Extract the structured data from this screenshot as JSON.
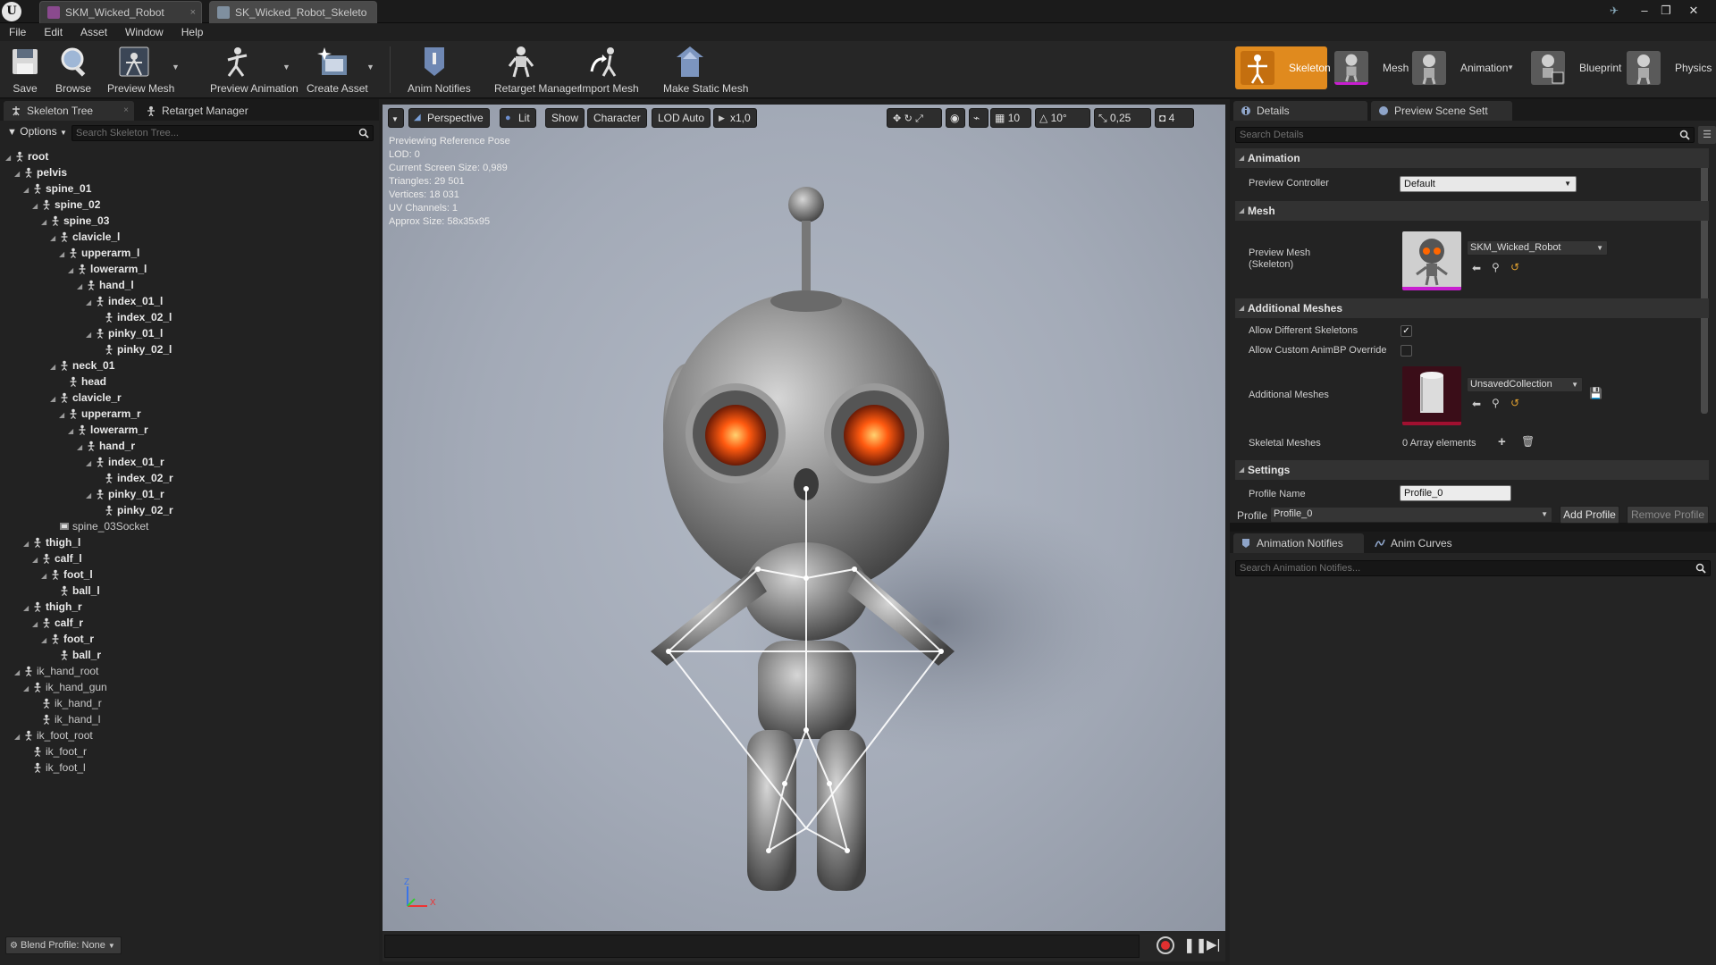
{
  "titlebar": {
    "tabs": [
      {
        "label": "SKM_Wicked_Robot"
      },
      {
        "label": "SK_Wicked_Robot_Skeleto"
      }
    ]
  },
  "menu": [
    "File",
    "Edit",
    "Asset",
    "Window",
    "Help"
  ],
  "toolbar": {
    "buttons": [
      {
        "label": "Save"
      },
      {
        "label": "Browse"
      },
      {
        "label": "Preview Mesh"
      },
      {
        "label": "Preview Animation"
      },
      {
        "label": "Create Asset"
      },
      {
        "label": "Anim Notifies"
      },
      {
        "label": "Retarget Manager"
      },
      {
        "label": "Import Mesh"
      },
      {
        "label": "Make Static Mesh"
      }
    ],
    "modes": [
      {
        "label": "Skeleton"
      },
      {
        "label": "Mesh"
      },
      {
        "label": "Animation"
      },
      {
        "label": "Blueprint"
      },
      {
        "label": "Physics"
      }
    ]
  },
  "left_panel": {
    "tabs": [
      "Skeleton Tree",
      "Retarget Manager"
    ],
    "options_label": "Options",
    "search_placeholder": "Search Skeleton Tree...",
    "tree": [
      {
        "name": "root",
        "depth": 0,
        "bold": true
      },
      {
        "name": "pelvis",
        "depth": 1,
        "bold": true
      },
      {
        "name": "spine_01",
        "depth": 2,
        "bold": true
      },
      {
        "name": "spine_02",
        "depth": 3,
        "bold": true
      },
      {
        "name": "spine_03",
        "depth": 4,
        "bold": true
      },
      {
        "name": "clavicle_l",
        "depth": 5,
        "bold": true
      },
      {
        "name": "upperarm_l",
        "depth": 6,
        "bold": true
      },
      {
        "name": "lowerarm_l",
        "depth": 7,
        "bold": true
      },
      {
        "name": "hand_l",
        "depth": 8,
        "bold": true
      },
      {
        "name": "index_01_l",
        "depth": 9,
        "bold": true
      },
      {
        "name": "index_02_l",
        "depth": 10,
        "bold": true
      },
      {
        "name": "pinky_01_l",
        "depth": 9,
        "bold": true
      },
      {
        "name": "pinky_02_l",
        "depth": 10,
        "bold": true
      },
      {
        "name": "neck_01",
        "depth": 5,
        "bold": true
      },
      {
        "name": "head",
        "depth": 6,
        "bold": true
      },
      {
        "name": "clavicle_r",
        "depth": 5,
        "bold": true
      },
      {
        "name": "upperarm_r",
        "depth": 6,
        "bold": true
      },
      {
        "name": "lowerarm_r",
        "depth": 7,
        "bold": true
      },
      {
        "name": "hand_r",
        "depth": 8,
        "bold": true
      },
      {
        "name": "index_01_r",
        "depth": 9,
        "bold": true
      },
      {
        "name": "index_02_r",
        "depth": 10,
        "bold": true
      },
      {
        "name": "pinky_01_r",
        "depth": 9,
        "bold": true
      },
      {
        "name": "pinky_02_r",
        "depth": 10,
        "bold": true
      },
      {
        "name": "spine_03Socket",
        "depth": 5,
        "bold": false,
        "socket": true
      },
      {
        "name": "thigh_l",
        "depth": 2,
        "bold": true
      },
      {
        "name": "calf_l",
        "depth": 3,
        "bold": true
      },
      {
        "name": "foot_l",
        "depth": 4,
        "bold": true
      },
      {
        "name": "ball_l",
        "depth": 5,
        "bold": true
      },
      {
        "name": "thigh_r",
        "depth": 2,
        "bold": true
      },
      {
        "name": "calf_r",
        "depth": 3,
        "bold": true
      },
      {
        "name": "foot_r",
        "depth": 4,
        "bold": true
      },
      {
        "name": "ball_r",
        "depth": 5,
        "bold": true
      },
      {
        "name": "ik_hand_root",
        "depth": 1,
        "bold": false
      },
      {
        "name": "ik_hand_gun",
        "depth": 2,
        "bold": false
      },
      {
        "name": "ik_hand_r",
        "depth": 3,
        "bold": false
      },
      {
        "name": "ik_hand_l",
        "depth": 3,
        "bold": false
      },
      {
        "name": "ik_foot_root",
        "depth": 1,
        "bold": false
      },
      {
        "name": "ik_foot_r",
        "depth": 2,
        "bold": false
      },
      {
        "name": "ik_foot_l",
        "depth": 2,
        "bold": false
      }
    ],
    "blend_profile": "Blend Profile: None"
  },
  "viewport": {
    "buttons": {
      "perspective": "Perspective",
      "lit": "Lit",
      "show": "Show",
      "character": "Character",
      "lod": "LOD Auto",
      "speed": "x1,0"
    },
    "right_controls": {
      "grid_snap": "10",
      "rot_snap": "10°",
      "scale_snap": "0,25",
      "cam_speed": "4"
    },
    "info": [
      "Previewing Reference Pose",
      "LOD: 0",
      "Current Screen Size: 0,989",
      "Triangles: 29 501",
      "Vertices: 18 031",
      "UV Channels: 1",
      "Approx Size: 58x35x95"
    ],
    "axis": {
      "z": "Z",
      "x": "X"
    }
  },
  "details": {
    "tabs": [
      "Details",
      "Preview Scene Sett"
    ],
    "search_placeholder": "Search Details",
    "sections": {
      "animation": "Animation",
      "mesh": "Mesh",
      "additional_meshes": "Additional Meshes",
      "settings": "Settings"
    },
    "preview_controller_label": "Preview Controller",
    "preview_controller_value": "Default",
    "preview_mesh_label": "Preview Mesh\n(Skeleton)",
    "preview_mesh_value": "SKM_Wicked_Robot",
    "allow_different_skeletons_label": "Allow Different Skeletons",
    "allow_different_skeletons": true,
    "allow_custom_animbp_label": "Allow Custom AnimBP Override",
    "allow_custom_animbp": false,
    "additional_meshes_label": "Additional Meshes",
    "additional_meshes_value": "UnsavedCollection",
    "skeletal_meshes_label": "Skeletal Meshes",
    "skeletal_meshes_value": "0 Array elements",
    "profile_name_label": "Profile Name",
    "profile_name_value": "Profile_0",
    "profile_label": "Profile",
    "profile_value": "Profile_0",
    "add_profile": "Add Profile",
    "remove_profile": "Remove Profile"
  },
  "notifies": {
    "tabs": [
      "Animation Notifies",
      "Anim Curves"
    ],
    "search_placeholder": "Search Animation Notifies..."
  },
  "colors": {
    "accent_orange": "#e08a1e",
    "mesh_magenta": "#c81ed0",
    "viewport_bg": "#a8afbb"
  }
}
